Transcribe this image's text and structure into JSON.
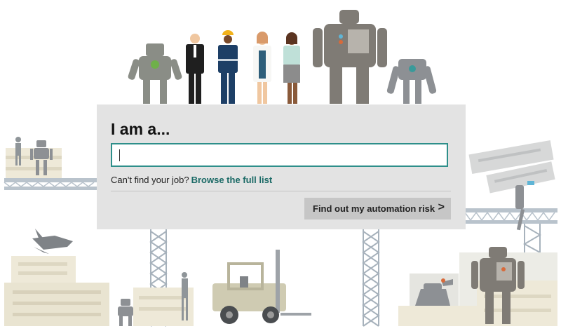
{
  "heading": "I am a...",
  "search": {
    "value": "",
    "placeholder": ""
  },
  "help": {
    "text": "Can't find your job?",
    "link_label": "Browse the full list"
  },
  "cta": {
    "label": "Find out my automation risk",
    "icon": "chevron-right-icon"
  },
  "colors": {
    "accent": "#2e8f8a",
    "link": "#1b6a66",
    "card_bg": "#e3e3e3",
    "button_bg": "#c6c6c6"
  }
}
